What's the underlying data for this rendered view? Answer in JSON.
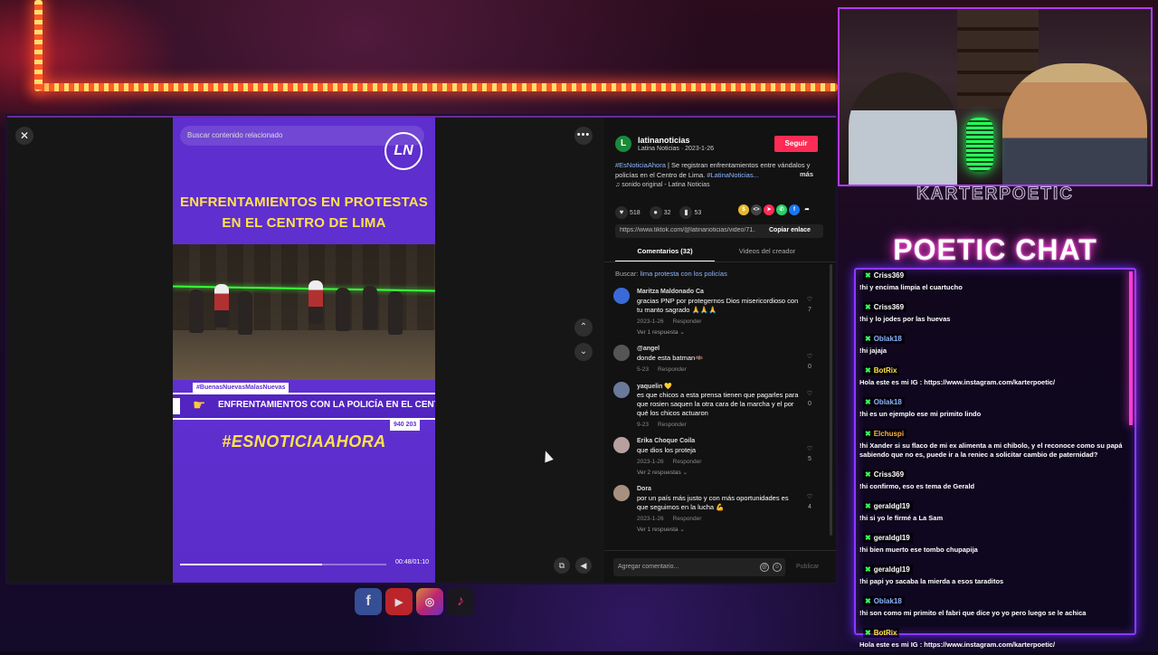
{
  "tiktok": {
    "search_placeholder": "Buscar contenido relacionado",
    "logo_text": "LN",
    "video": {
      "headline_line1": "ENFRENTAMIENTOS EN PROTESTAS",
      "headline_line2": "EN EL CENTRO DE LIMA",
      "tag": "#BuenasNuevasMalasNuevas",
      "band_text": "ENFRENTAMIENTOS CON LA POLICÍA EN EL CENTRO DE",
      "phone": "940 203",
      "hashtag": "#ESNOTICIAAHORA",
      "time": "00:48/01:10",
      "progress": 0.69
    },
    "author": {
      "avatar_letter": "L",
      "name": "latinanoticias",
      "sub": "Latina Noticias · 2023-1-26",
      "follow_label": "Seguir"
    },
    "description": {
      "hashtag1": "#EsNoticiaAhora",
      "text": " | Se registran enfrentamientos entre vándalos y policías en el Centro de Lima. ",
      "hashtag2": "#LatinaNoticias...",
      "more": "más"
    },
    "sound": "sonido original - Latina Noticias",
    "stats": {
      "likes": "518",
      "comments": "32",
      "saves": "53"
    },
    "url": "https://www.tiktok.com/@latinanoticias/video/71...",
    "copy_label": "Copiar enlace",
    "tabs": {
      "comments": "Comentarios (32)",
      "creator": "Videos del creador"
    },
    "search_label": "Buscar:",
    "search_query": "lima protesta con los policías",
    "comments": [
      {
        "user": "Maritza Maldonado Ca",
        "text": "gracias PNP por protegernos Dios misericordioso con tu manto sagrado 🙏🙏🙏",
        "date": "2023-1-26",
        "reply": "Responder",
        "replies": "Ver 1 respuesta ⌄",
        "likes": "7",
        "avatar_color": "#3a6ad8"
      },
      {
        "user": "@angel",
        "text": "donde esta batman🦇",
        "date": "5-23",
        "reply": "Responder",
        "replies": "",
        "likes": "0",
        "avatar_color": "#555555"
      },
      {
        "user": "yaquelin 💛",
        "text": "es que chicos a esta prensa tienen que pagarles para que rosien saquen la otra cara de la marcha y el por qué los chicos actuaron",
        "date": "9-23",
        "reply": "Responder",
        "replies": "",
        "likes": "0",
        "avatar_color": "#6a7a9a"
      },
      {
        "user": "Erika Choque Coila",
        "text": "que dios los proteja",
        "date": "2023-1-26",
        "reply": "Responder",
        "replies": "Ver 2 respuestas ⌄",
        "likes": "5",
        "avatar_color": "#b8a0a0"
      },
      {
        "user": "Dora",
        "text": "por un país más justo y con más oportunidades es que seguimos en la lucha 💪",
        "date": "2023-1-26",
        "reply": "Responder",
        "replies": "Ver 1 respuesta ⌄",
        "likes": "4",
        "avatar_color": "#a89080"
      }
    ],
    "comment_placeholder": "Agregar comentario...",
    "publish_label": "Publicar"
  },
  "overlay": {
    "brand": "KARTERPOETIC",
    "chat_title": "POETIC CHAT",
    "socials": [
      "f",
      "▶",
      "◎",
      "♪"
    ]
  },
  "chat": [
    {
      "user": "Criss369",
      "text": "!hi y encima limpia el cuartucho",
      "color": "#ffffff"
    },
    {
      "user": "Criss369",
      "text": "!hi y lo jodes por las huevas",
      "color": "#ffffff"
    },
    {
      "user": "Oblak18",
      "text": "!hi jajaja",
      "color": "#8ab4ff"
    },
    {
      "user": "BotRix",
      "text": "Hola este es mi IG : https://www.instagram.com/karterpoetic/",
      "color": "#ffe24a"
    },
    {
      "user": "Oblak18",
      "text": "!hi es un ejemplo ese mi primito lindo",
      "color": "#8ab4ff"
    },
    {
      "user": "Elchuspi",
      "text": "!hi Xander si su flaco de mi ex alimenta a mi chibolo, y el reconoce como su papá sabiendo que no es, puede ir a la reniec a solicitar cambio de paternidad?",
      "color": "#ffb23a"
    },
    {
      "user": "Criss369",
      "text": "!hi confirmo, eso es tema de Gerald",
      "color": "#ffffff"
    },
    {
      "user": "geraldgl19",
      "text": "!hi si yo le firmé a La Sam",
      "color": "#ffffff"
    },
    {
      "user": "geraldgl19",
      "text": "!hi bien muerto ese tombo chupapija",
      "color": "#ffffff"
    },
    {
      "user": "geraldgl19",
      "text": "!hi papi yo sacaba la mierda a esos taraditos",
      "color": "#ffffff"
    },
    {
      "user": "Oblak18",
      "text": "!hi son como mi primito el fabri que dice yo yo pero luego se le achica",
      "color": "#8ab4ff"
    },
    {
      "user": "BotRix",
      "text": "Hola este es mi IG : https://www.instagram.com/karterpoetic/",
      "color": "#ffe24a"
    }
  ]
}
